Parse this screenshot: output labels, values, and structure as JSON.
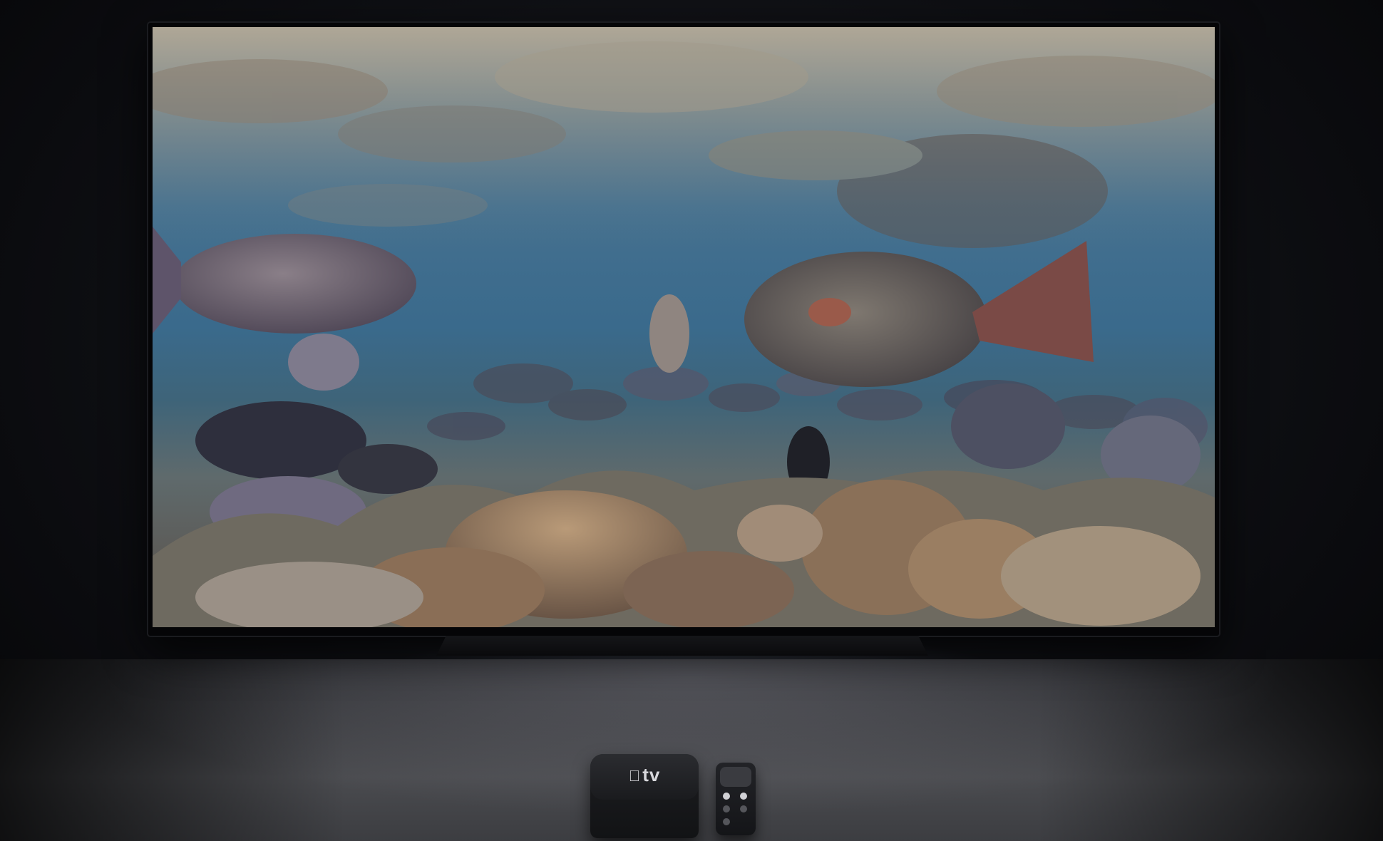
{
  "scene": {
    "description_label": "",
    "colors": {
      "background": "#0c0c10",
      "floor": "#3a3b3f",
      "tv_bezel": "#050507",
      "device": "#1a1b1e"
    }
  },
  "device": {
    "logo_symbol": "",
    "logo_text": "tv"
  }
}
